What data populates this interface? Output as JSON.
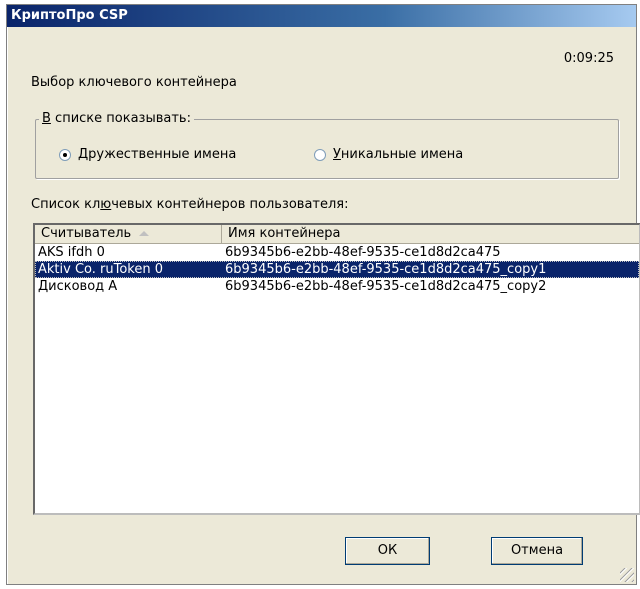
{
  "window": {
    "title": "КриптоПро CSP",
    "timer": "0:09:25"
  },
  "prompt": "Выбор ключевого контейнера",
  "show_group": {
    "legend_first": "В",
    "legend_rest": " списке показывать:",
    "options": [
      {
        "first": "Д",
        "rest": "ружественные имена",
        "selected": true
      },
      {
        "first": "У",
        "rest": "никальные имена",
        "selected": false
      }
    ]
  },
  "list_label": {
    "before": "Список кл",
    "underlined": "ю",
    "after": "чевых контейнеров пользователя:"
  },
  "columns": [
    "Считыватель",
    "Имя контейнера"
  ],
  "rows": [
    {
      "reader": "AKS ifdh 0",
      "container": "6b9345b6-e2bb-48ef-9535-ce1d8d2ca475",
      "selected": false
    },
    {
      "reader": "Aktiv Co. ruToken 0",
      "container": "6b9345b6-e2bb-48ef-9535-ce1d8d2ca475_copy1",
      "selected": true
    },
    {
      "reader": "Дисковод A",
      "container": "6b9345b6-e2bb-48ef-9535-ce1d8d2ca475_copy2",
      "selected": false
    }
  ],
  "buttons": {
    "ok": "ОК",
    "cancel": "Отмена"
  },
  "icons": {
    "sort": "sort-ascending-icon",
    "resize": "resize-grip-icon"
  },
  "colors": {
    "title_gradient_start": "#0a246a",
    "selection": "#0a246a",
    "dialog_bg": "#ece9d8"
  }
}
